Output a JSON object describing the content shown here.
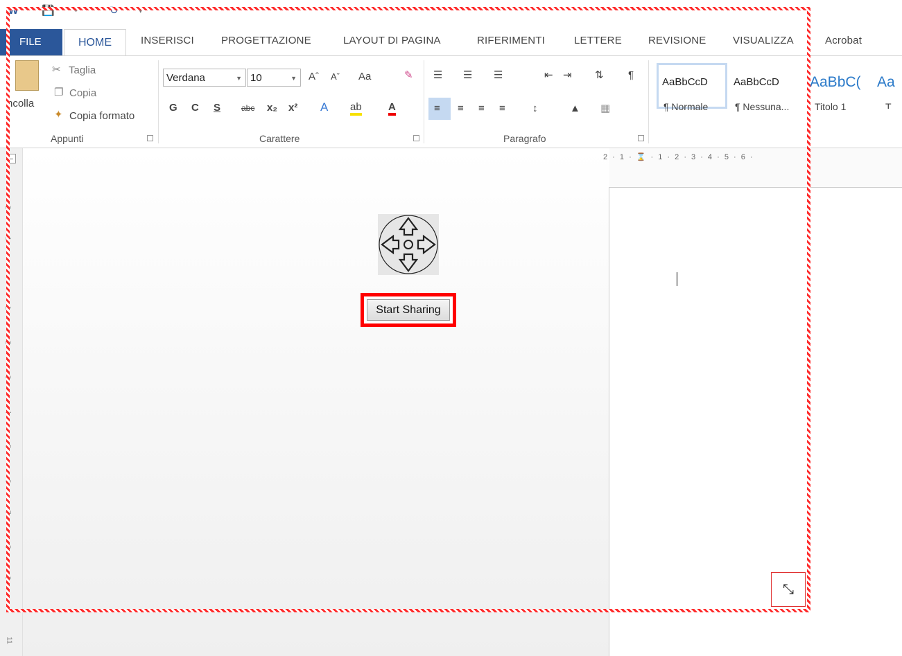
{
  "quick_access": {
    "word_icon": "word-icon",
    "save_icon": "save-icon",
    "undo_icon": "undo-icon",
    "redo_icon": "redo-icon",
    "customize_icon": "customize-qat-icon"
  },
  "tabs": {
    "file": "FILE",
    "home": "HOME",
    "insert": "INSERISCI",
    "design": "PROGETTAZIONE",
    "layout": "LAYOUT DI PAGINA",
    "references": "RIFERIMENTI",
    "mailings": "LETTERE",
    "review": "REVISIONE",
    "view": "VISUALIZZA",
    "acrobat": "Acrobat"
  },
  "ribbon": {
    "clipboard": {
      "paste": "ncolla",
      "cut": "Taglia",
      "copy": "Copia",
      "format_painter": "Copia formato",
      "label": "Appunti"
    },
    "font": {
      "font_name": "Verdana",
      "font_size": "10",
      "bold": "G",
      "italic": "C",
      "underline": "S",
      "strikethrough": "abc",
      "change_case": "Aa",
      "label": "Carattere"
    },
    "paragraph": {
      "label": "Paragrafo"
    },
    "styles": {
      "items": [
        {
          "preview": "AaBbCcD",
          "name": "¶ Normale"
        },
        {
          "preview": "AaBbCcD",
          "name": "¶ Nessuna..."
        },
        {
          "preview": "AaBbC(",
          "name": "Titolo 1"
        },
        {
          "preview": "Aa",
          "name": "T"
        }
      ]
    }
  },
  "ruler": {
    "horizontal": "2 · 1 · ⌛ · 1 · 2 · 3 · 4 · 5 · 6 ·",
    "vertical_numbers": [
      "2",
      "1",
      "1",
      "2",
      "3",
      "4",
      "5",
      "6",
      "7",
      "8",
      "9",
      "11"
    ]
  },
  "sharing": {
    "icon": "move-arrows-icon",
    "button_label": "Start Sharing"
  },
  "colors": {
    "accent": "#2b579a",
    "highlight_frame": "#ff0000",
    "dashed_border": "#ff2a2a"
  }
}
